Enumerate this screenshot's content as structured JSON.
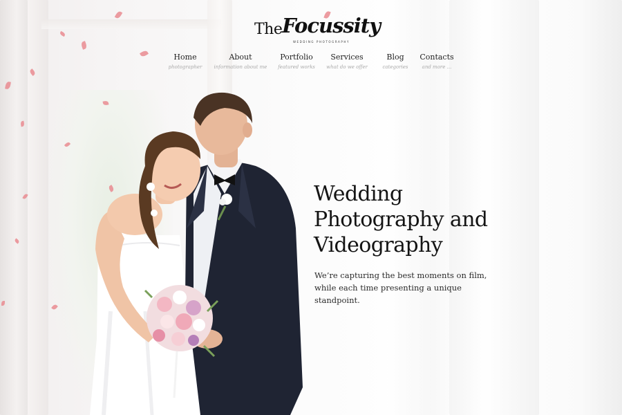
{
  "logo": {
    "prefix": "The",
    "script": "Focussity",
    "tagline": "WEDDING PHOTOGRAPHY"
  },
  "nav": [
    {
      "label": "Home",
      "sub": "photographer"
    },
    {
      "label": "About",
      "sub": "information about me"
    },
    {
      "label": "Portfolio",
      "sub": "featured works"
    },
    {
      "label": "Services",
      "sub": "what do we offer"
    },
    {
      "label": "Blog",
      "sub": "categories"
    },
    {
      "label": "Contacts",
      "sub": "and more ..."
    }
  ],
  "hero": {
    "title_lines": [
      "Wedding",
      "Photography and",
      "Videography"
    ],
    "description": "We’re capturing the best moments on film, while each time presenting a unique standpoint."
  },
  "colors": {
    "accent_petal": "#e98b90",
    "text": "#141414",
    "suit": "#1f2433",
    "dress": "#ffffff"
  }
}
